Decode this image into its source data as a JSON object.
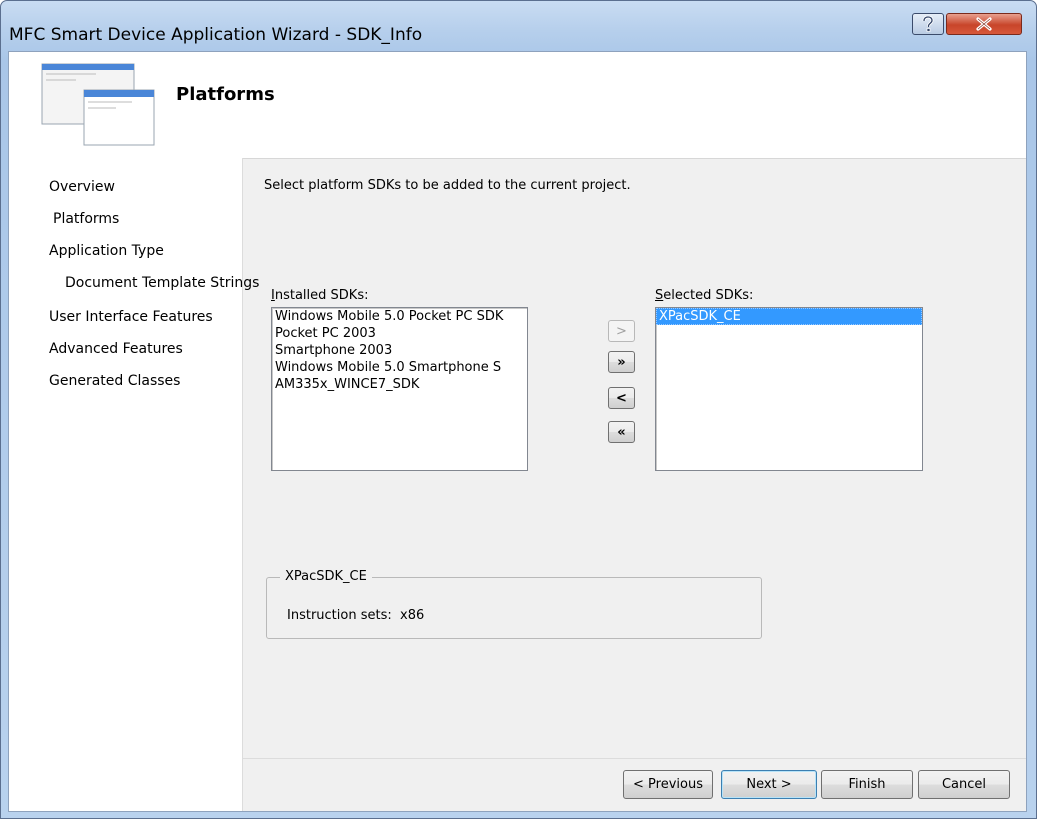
{
  "window": {
    "title": "MFC Smart Device Application Wizard - SDK_Info"
  },
  "header": {
    "title": "Platforms",
    "icon": "wizard-windows-icon"
  },
  "nav": {
    "items": [
      {
        "label": "Overview"
      },
      {
        "label": "Platforms"
      },
      {
        "label": "Application Type"
      },
      {
        "label": "Document Template Strings"
      },
      {
        "label": "User Interface Features"
      },
      {
        "label": "Advanced Features"
      },
      {
        "label": "Generated Classes"
      }
    ]
  },
  "main": {
    "instruction": "Select platform SDKs to be added to the current project.",
    "installed": {
      "label": "Installed SDKs:",
      "items": [
        "Windows Mobile 5.0 Pocket PC SDK",
        "Pocket PC 2003",
        "Smartphone 2003",
        "Windows Mobile 5.0 Smartphone S",
        "AM335x_WINCE7_SDK"
      ]
    },
    "selected": {
      "label": "Selected SDKs:",
      "items": [
        "XPacSDK_CE"
      ]
    },
    "move_buttons": {
      "add": ">",
      "add_all": "»",
      "remove": "<",
      "remove_all": "«"
    },
    "details": {
      "legend": "XPacSDK_CE",
      "instruction_sets_label": "Instruction sets:",
      "instruction_sets_value": "x86"
    }
  },
  "footer": {
    "previous": "< Previous",
    "next": "Next >",
    "finish": "Finish",
    "cancel": "Cancel"
  },
  "colors": {
    "selection": "#3399ff",
    "title_bar": "#b6cfec",
    "close_button": "#c8452a"
  }
}
